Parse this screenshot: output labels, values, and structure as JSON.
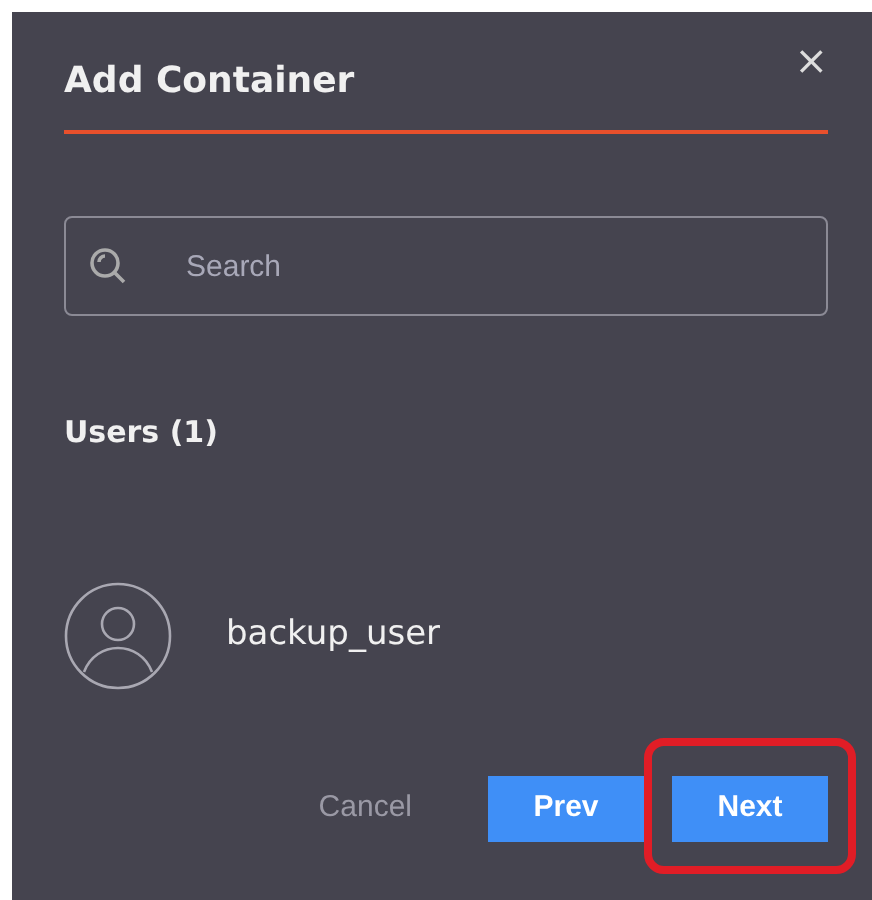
{
  "dialog": {
    "title": "Add Container",
    "close": "×"
  },
  "search": {
    "placeholder": "Search"
  },
  "section": {
    "heading": "Users (1)"
  },
  "users": [
    {
      "name": "backup_user"
    }
  ],
  "buttons": [
    {
      "label": "Cancel",
      "kind": "text",
      "highlighted": false
    },
    {
      "label": "Prev",
      "kind": "primary",
      "highlighted": false
    },
    {
      "label": "Next",
      "kind": "primary",
      "highlighted": true
    }
  ]
}
